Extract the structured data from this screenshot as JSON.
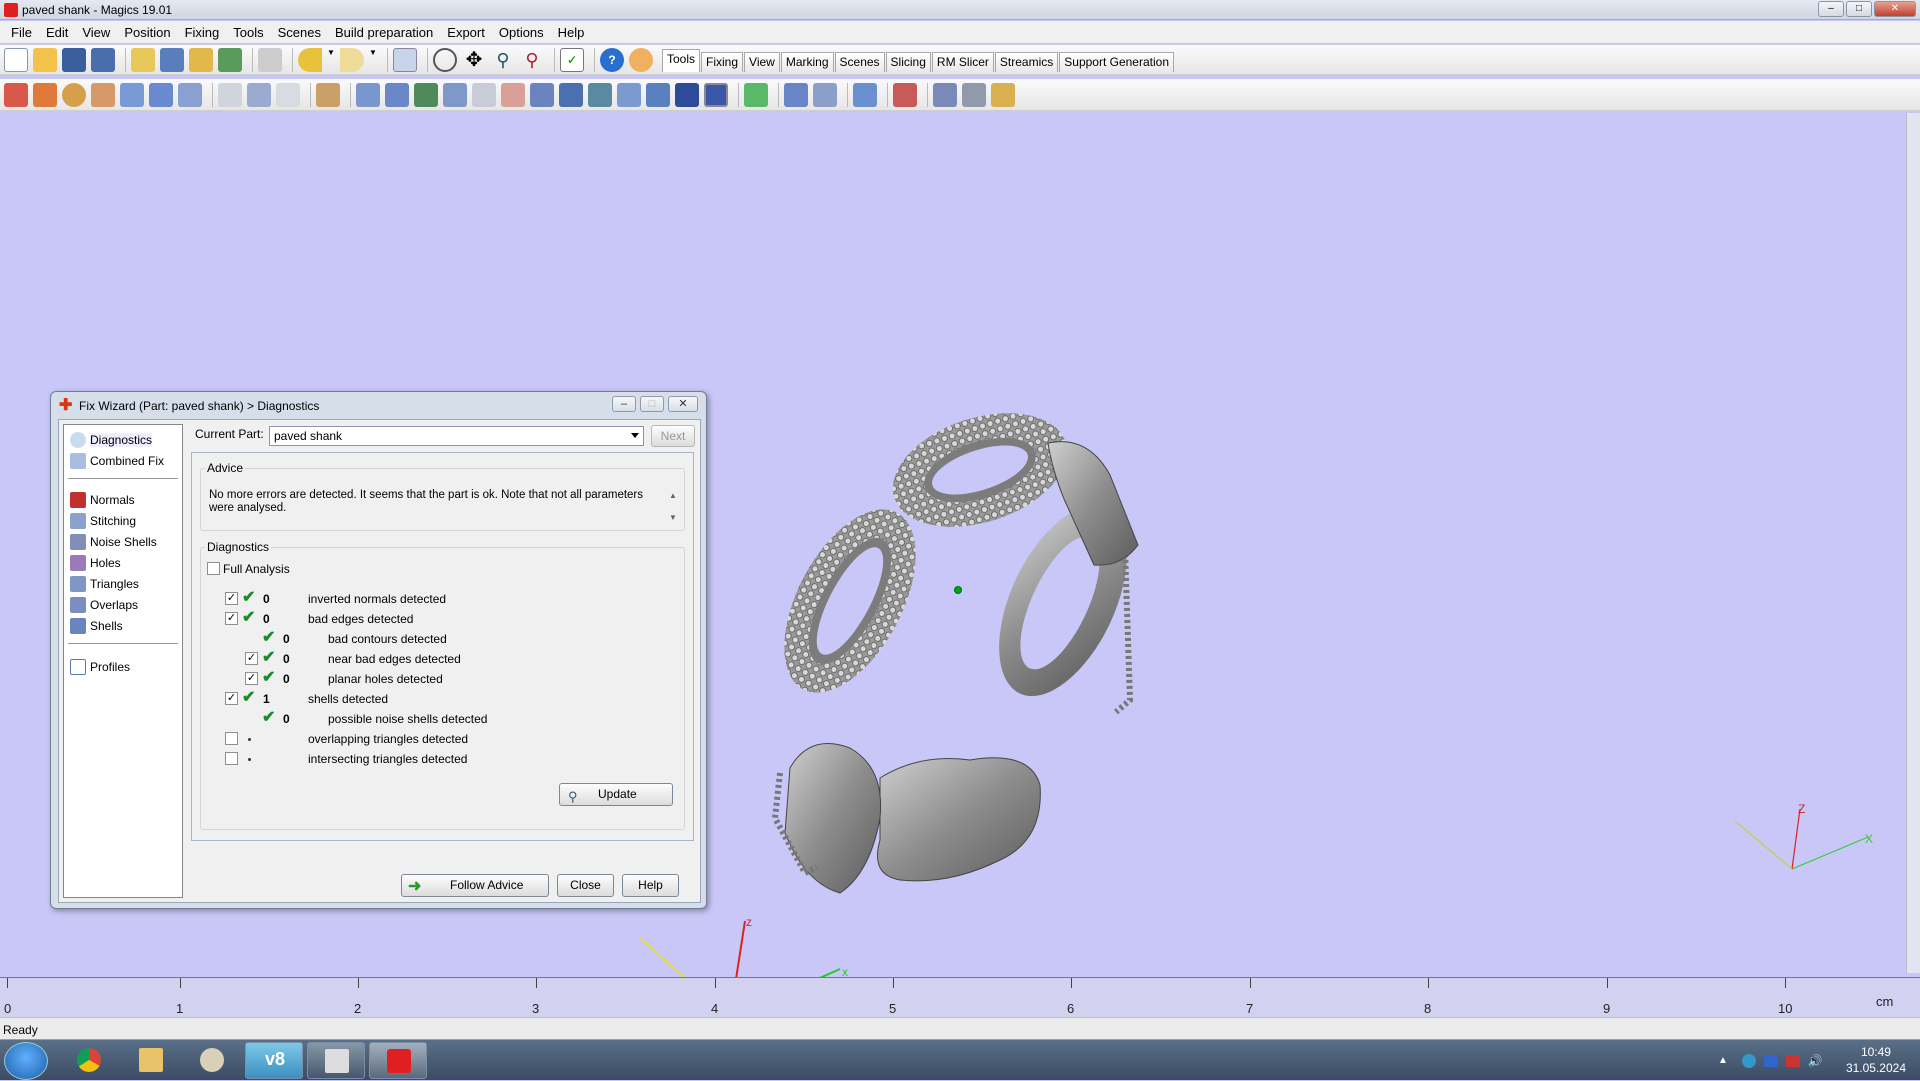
{
  "window": {
    "title": "paved shank - Magics 19.01"
  },
  "menu": [
    "File",
    "Edit",
    "View",
    "Position",
    "Fixing",
    "Tools",
    "Scenes",
    "Build preparation",
    "Export",
    "Options",
    "Help"
  ],
  "tabs": [
    "Tools",
    "Fixing",
    "View",
    "Marking",
    "Scenes",
    "Slicing",
    "RM Slicer",
    "Streamics",
    "Support Generation"
  ],
  "dialog": {
    "title": "Fix Wizard (Part: paved shank) > Diagnostics",
    "nav": [
      "Diagnostics",
      "Combined Fix",
      "Normals",
      "Stitching",
      "Noise Shells",
      "Holes",
      "Triangles",
      "Overlaps",
      "Shells",
      "Profiles"
    ],
    "current_part_label": "Current Part:",
    "current_part_value": "paved shank",
    "next_label": "Next",
    "advice_legend": "Advice",
    "advice_text": "No more errors are detected. It seems that the part is ok. Note that not all parameters were analysed.",
    "diag_legend": "Diagnostics",
    "full_analysis": "Full Analysis",
    "rows": [
      {
        "count": "0",
        "label": "inverted normals detected"
      },
      {
        "count": "0",
        "label": "bad edges detected"
      },
      {
        "count": "0",
        "label": "bad contours detected"
      },
      {
        "count": "0",
        "label": "near bad edges detected"
      },
      {
        "count": "0",
        "label": "planar holes detected"
      },
      {
        "count": "1",
        "label": "shells detected"
      },
      {
        "count": "0",
        "label": "possible noise shells detected"
      },
      {
        "count": "",
        "label": "overlapping triangles detected"
      },
      {
        "count": "",
        "label": "intersecting triangles detected"
      }
    ],
    "update_label": "Update",
    "follow_label": "Follow Advice",
    "close_label": "Close",
    "help_label": "Help"
  },
  "ruler": {
    "labels": [
      "0",
      "1",
      "2",
      "3",
      "4",
      "5",
      "6",
      "7",
      "8",
      "9",
      "10"
    ],
    "unit": "cm"
  },
  "axes": {
    "x": "x",
    "z": "z",
    "X": "X",
    "Z": "Z"
  },
  "status": "Ready",
  "clock": {
    "time": "10:49",
    "date": "31.05.2024"
  },
  "colors": {
    "viewport": "#c9c7f7",
    "check": "#1b8a2a",
    "part": "#9a9a9a"
  }
}
